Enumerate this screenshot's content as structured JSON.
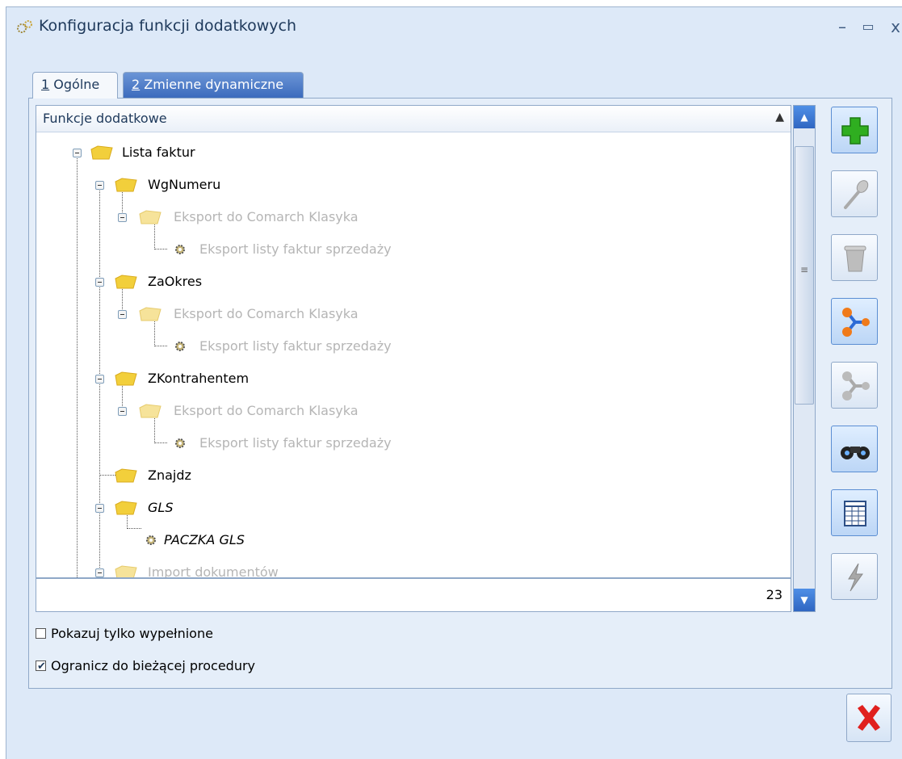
{
  "window": {
    "title": "Konfiguracja funkcji dodatkowych",
    "minimize": "–",
    "maximize": "▭",
    "close": "x"
  },
  "tabs": [
    {
      "key": "1",
      "label": " Ogólne"
    },
    {
      "key": "2",
      "label": " Zmienne dynamiczne"
    }
  ],
  "tree": {
    "header": "Funkcje dodatkowe",
    "sort_indicator": "▲",
    "nodes": [
      {
        "label": "Lista faktur"
      },
      {
        "label": "WgNumeru"
      },
      {
        "label": "Eksport do Comarch Klasyka"
      },
      {
        "label": "Eksport listy faktur sprzedaży"
      },
      {
        "label": "ZaOkres"
      },
      {
        "label": "Eksport do Comarch Klasyka"
      },
      {
        "label": "Eksport listy faktur sprzedaży"
      },
      {
        "label": "ZKontrahentem"
      },
      {
        "label": "Eksport do Comarch Klasyka"
      },
      {
        "label": "Eksport listy faktur sprzedaży"
      },
      {
        "label": "Znajdz"
      },
      {
        "label": "GLS"
      },
      {
        "label": "PACZKA GLS"
      },
      {
        "label": "Import dokumentów"
      }
    ],
    "count": "23"
  },
  "options": {
    "show_filled_only": {
      "label": "Pokazuj tylko wypełnione",
      "checked": false
    },
    "limit_to_procedure": {
      "label": "Ogranicz do bieżącej procedury",
      "checked": true
    }
  },
  "toolbar": [
    {
      "icon": "add-icon"
    },
    {
      "icon": "edit-icon"
    },
    {
      "icon": "delete-icon"
    },
    {
      "icon": "attach-icon"
    },
    {
      "icon": "detach-icon"
    },
    {
      "icon": "search-icon"
    },
    {
      "icon": "columns-icon"
    },
    {
      "icon": "run-icon"
    }
  ],
  "colors": {
    "accent": "#3c6bbd",
    "disabled_text": "#b5b5b5",
    "add_green": "#2fae20",
    "close_red": "#e0201e"
  }
}
